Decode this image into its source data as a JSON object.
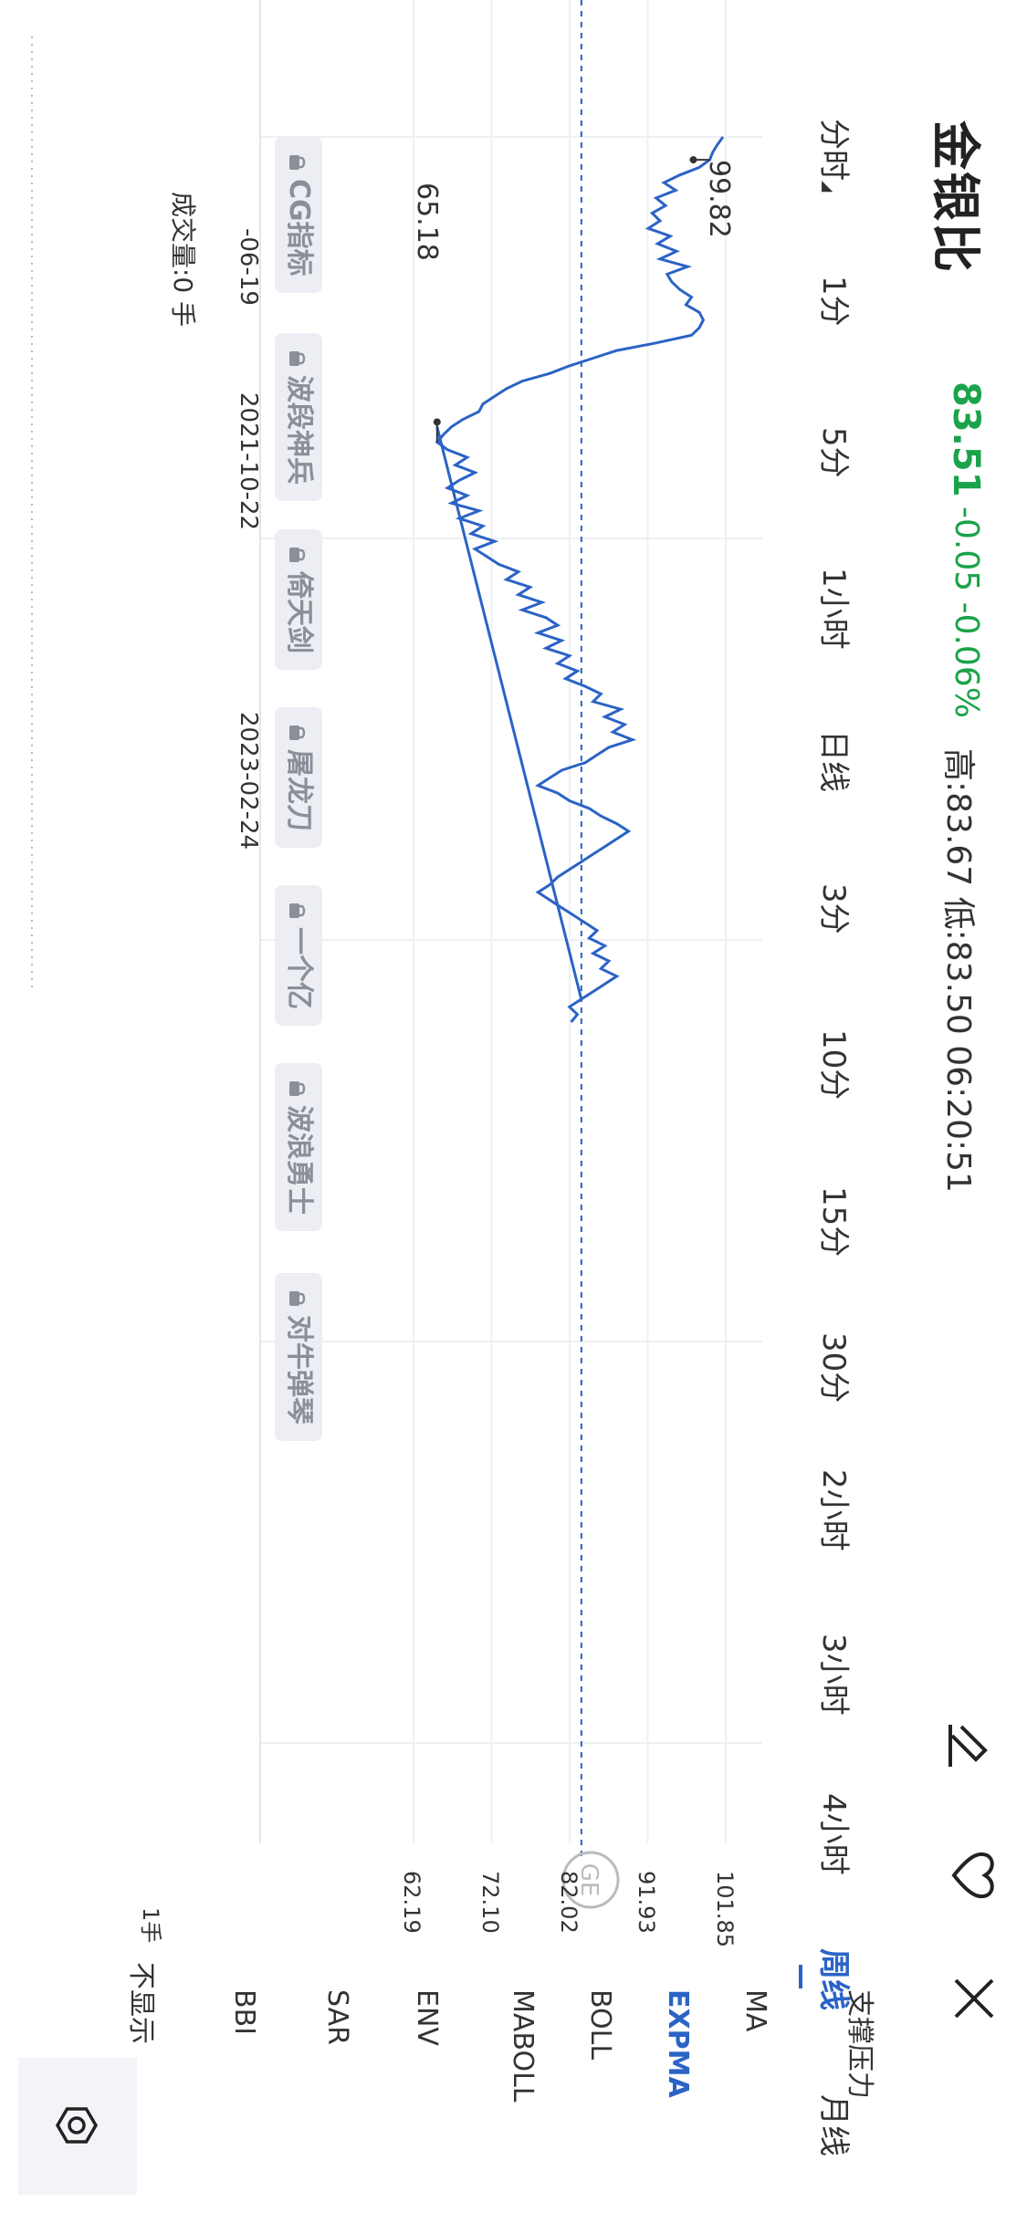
{
  "header": {
    "title": "金银比",
    "price": "83.51",
    "change": "-0.05 -0.06%",
    "hilo": "高:83.67 低:83.50 06:20:51"
  },
  "tabs": [
    {
      "label": "分时",
      "active": false
    },
    {
      "label": "1分",
      "active": false
    },
    {
      "label": "5分",
      "active": false
    },
    {
      "label": "1小时",
      "active": false
    },
    {
      "label": "日线",
      "active": false
    },
    {
      "label": "3分",
      "active": false
    },
    {
      "label": "10分",
      "active": false
    },
    {
      "label": "15分",
      "active": false
    },
    {
      "label": "30分",
      "active": false
    },
    {
      "label": "2小时",
      "active": false
    },
    {
      "label": "3小时",
      "active": false
    },
    {
      "label": "4小时",
      "active": false
    },
    {
      "label": "周线",
      "active": true
    },
    {
      "label": "月线",
      "active": false
    }
  ],
  "panel": {
    "header": "支撑压力",
    "items": [
      {
        "label": "MA",
        "active": false
      },
      {
        "label": "EXPMA",
        "active": true
      },
      {
        "label": "BOLL",
        "active": false
      },
      {
        "label": "MABOLL",
        "active": false
      },
      {
        "label": "ENV",
        "active": false
      },
      {
        "label": "SAR",
        "active": false
      },
      {
        "label": "BBI",
        "active": false
      },
      {
        "label": "不显示",
        "active": false
      }
    ]
  },
  "chips": [
    "CG指标",
    "波段神兵",
    "倚天剑",
    "屠龙刀",
    "一个亿",
    "波浪勇士",
    "对牛弹琴"
  ],
  "axis": {
    "y_ticks": [
      "101.85",
      "91.93",
      "82.02",
      "72.10",
      "62.19"
    ],
    "x_ticks": [
      "-06-19",
      "2021-10-22",
      "2023-02-24"
    ],
    "max_label": "99.82",
    "min_label": "65.18",
    "volume_label": "成交量:0 手",
    "volume_axis": "1手"
  },
  "chart_data": {
    "type": "line",
    "series": [
      {
        "values": [
          101.5,
          100.8,
          100.2,
          99.82,
          98.5,
          96.0,
          94.0,
          95.5,
          93.0,
          94.2,
          92.5,
          93.5,
          92.0,
          94.8,
          93.2,
          95.6,
          93.5,
          97.0,
          94.4,
          95.0,
          96.0,
          97.5,
          96.8,
          98.5,
          99.0,
          98.5,
          97.5,
          93.0,
          88.0,
          85.0,
          82.0,
          79.5,
          76.0,
          74.0,
          72.5,
          71.0,
          70.5,
          68.5,
          67.0,
          66.0,
          65.18,
          66.5,
          69.0,
          67.5,
          70.0,
          68.0,
          66.5,
          69.0,
          67.0,
          70.5,
          68.0,
          71.0,
          69.5,
          72.5,
          70.0,
          71.5,
          73.0,
          75.5,
          74.0,
          77.0,
          75.5,
          78.5,
          76.0,
          79.0,
          80.5,
          78.0,
          81.0,
          79.0,
          82.0,
          80.5,
          83.0,
          81.5,
          84.0,
          86.0,
          85.0,
          88.5,
          86.5,
          89.0,
          87.5,
          90.0,
          87.0,
          85.5,
          84.0,
          81.0,
          79.5,
          78.0,
          80.5,
          82.0,
          84.5,
          86.0,
          88.0,
          89.5,
          88.0,
          86.5,
          85.0,
          83.5,
          82.0,
          80.5,
          79.5,
          78.0,
          79.5,
          81.0,
          82.5,
          84.0,
          85.5,
          84.5,
          86.5,
          85.0,
          87.0,
          86.0,
          88.0,
          86.5,
          85.0,
          83.5,
          82.0,
          83.0,
          82.2
        ]
      }
    ],
    "ylim": [
      62.19,
      101.85
    ],
    "support_line": {
      "from": [
        38,
        65.18
      ],
      "to": [
        113,
        83.5
      ]
    },
    "reference_value": 83.51
  }
}
